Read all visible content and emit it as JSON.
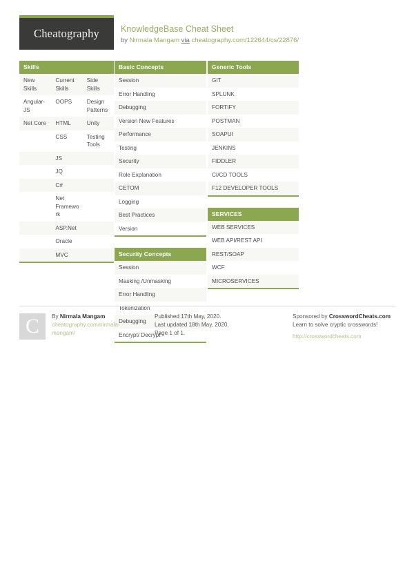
{
  "header": {
    "logo_text": "Cheatography",
    "title": "KnowledgeBase Cheat Sheet",
    "by_prefix": "by ",
    "author": "Nirmala Mangam",
    "via": "via",
    "url": "cheatography.com/122644/cs/22876/"
  },
  "blocks": {
    "skills": {
      "header": "Skills",
      "rows": [
        [
          "New Skills",
          "Current Skills",
          "Side Skills"
        ],
        [
          "Angular‐JS",
          "OOPS",
          "Design Patterns"
        ],
        [
          "Net Core",
          "HTML",
          "Unity"
        ],
        [
          "",
          "CSS",
          "Testing Tools"
        ],
        [
          "",
          "JS",
          ""
        ],
        [
          "",
          "JQ",
          ""
        ],
        [
          "",
          "C#",
          ""
        ],
        [
          "",
          "Net Framework",
          ""
        ],
        [
          "",
          "ASP.Net",
          ""
        ],
        [
          "",
          "Oracle",
          ""
        ],
        [
          "",
          "MVC",
          ""
        ]
      ]
    },
    "basic_concepts": {
      "header": "Basic Concepts",
      "rows": [
        "Session",
        "Error Handling",
        "Debugging",
        "Version New Features",
        "Performance",
        "Testing",
        "Security",
        "Role Explanation",
        "CETOM",
        "Logging",
        "Best Practices",
        "Version"
      ]
    },
    "security_concepts": {
      "header": "Security Concepts",
      "rows": [
        "Session",
        "Masking /Unmasking",
        "Error Handling",
        "Tokenization",
        "Debugging",
        "Encrypt/ Decrypt"
      ]
    },
    "generic_tools": {
      "header": "Generic Tools",
      "rows": [
        "GIT",
        "SPLUNK",
        "FORTIFY",
        "POSTMAN",
        "SOAPUI",
        "JENKINS",
        "FIDDLER",
        "CI/CD TOOLS",
        "F12 DEVELOPER TOOLS"
      ]
    },
    "services": {
      "header": "SERVICES",
      "rows": [
        "WEB SERVICES",
        "WEB API/REST API",
        "REST/SOAP",
        "WCF",
        "MICROSERVICES"
      ]
    }
  },
  "footer": {
    "avatar_letter": "C",
    "by_label": "By ",
    "author": "Nirmala Mangam",
    "profile_url_line1": "cheatography.com/nirmala-",
    "profile_url_line2": "mangam/",
    "published": "Published 17th May, 2020.",
    "last_updated": "Last updated 18th May, 2020.",
    "page_of": "Page 1 of 1.",
    "sponsored_prefix": "Sponsored by ",
    "sponsor_name": "CrosswordCheats.com",
    "sponsor_tagline": "Learn to solve cryptic crosswords!",
    "sponsor_url": "http://crosswordcheats.com"
  },
  "colors": {
    "accent_green": "#8ba750",
    "title_green": "#9aab63",
    "logo_dark": "#3a3a38",
    "row_alt": "#f7f7f4"
  }
}
